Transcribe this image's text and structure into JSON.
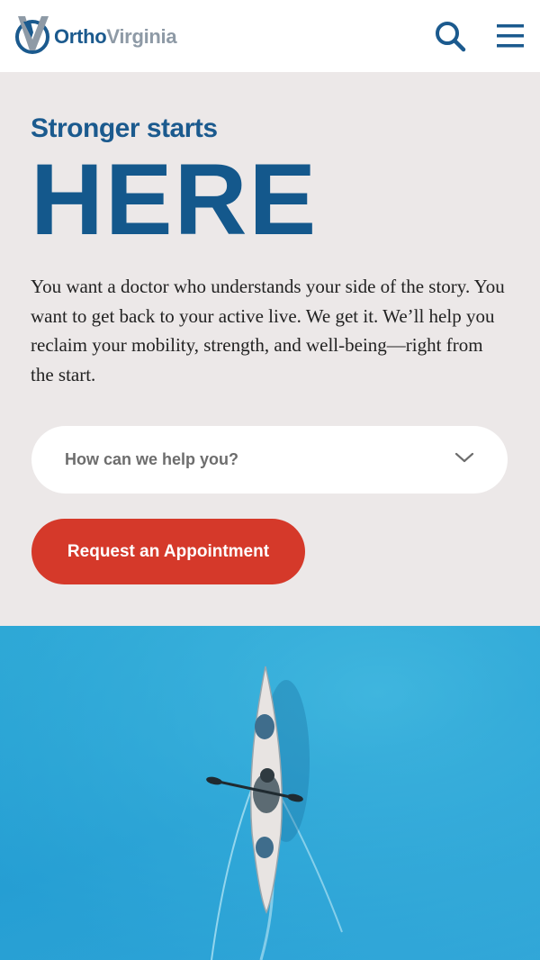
{
  "header": {
    "logo": {
      "part1": "Ortho",
      "part2": "Virginia",
      "icon": "checkmark-v-logo-icon"
    },
    "search_icon": "search-icon",
    "menu_icon": "hamburger-menu-icon"
  },
  "hero": {
    "tagline": "Stronger starts",
    "headline": "HERE",
    "intro": "You want a doctor who understands your side of the story. You want to get back to your active live. We get it. We’ll help you reclaim your mobility, strength, and well-being—right from the start.",
    "help_select": {
      "label": "How can we help you?",
      "icon": "chevron-down-icon"
    },
    "cta_label": "Request an Appointment"
  },
  "photo": {
    "subject": "kayak-on-water-image"
  },
  "colors": {
    "brand_blue": "#1b5a8e",
    "cta_red": "#d5392a",
    "hero_bg": "#ece8e8",
    "water": "#2aa3d6"
  }
}
